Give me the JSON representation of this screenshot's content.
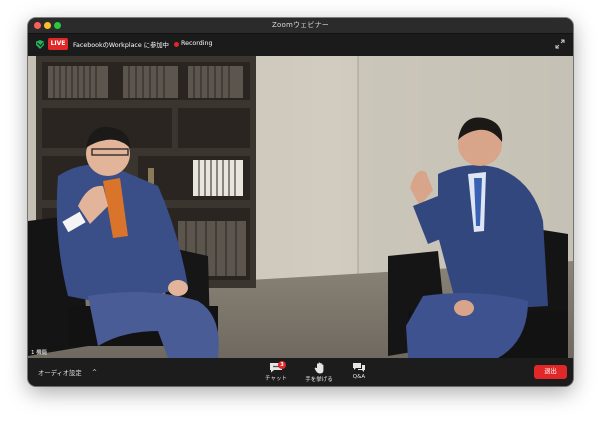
{
  "window": {
    "title": "Zoomウェビナー"
  },
  "topbar": {
    "live_badge": "LIVE",
    "facebook_status": "FacebookのWorkplace に参加中",
    "recording_label": "Recording"
  },
  "video": {
    "participant_count": "1 機能"
  },
  "bottombar": {
    "audio_settings": "オーディオ設定",
    "audio_caret": "^",
    "chat_label": "チャット",
    "chat_badge": "3",
    "raise_hand_label": "手を挙げる",
    "qa_label": "Q&A",
    "leave_label": "退出"
  },
  "colors": {
    "leave": "#e02828",
    "live": "#e02828",
    "shield": "#23b35a",
    "bar": "#1c1c1c"
  }
}
